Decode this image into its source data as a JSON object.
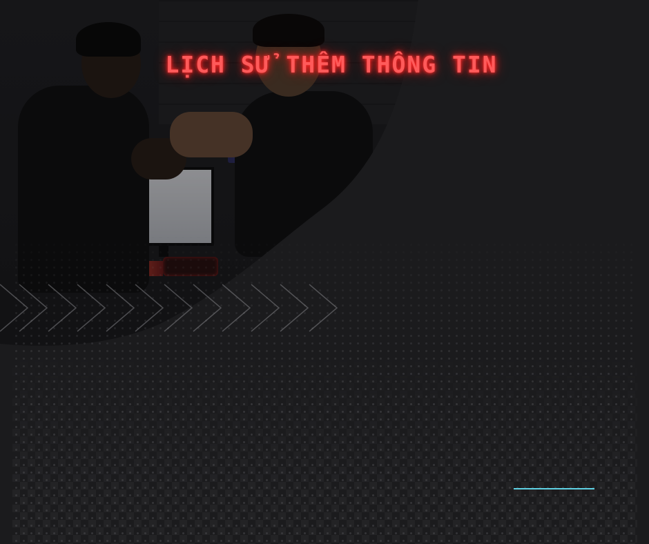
{
  "title": "LỊCH SỬ THÊM THÔNG TIN",
  "colors": {
    "background": "#1b1b1d",
    "title_neon": "#ff5a5a",
    "accent_line": "#5fd3e6"
  }
}
